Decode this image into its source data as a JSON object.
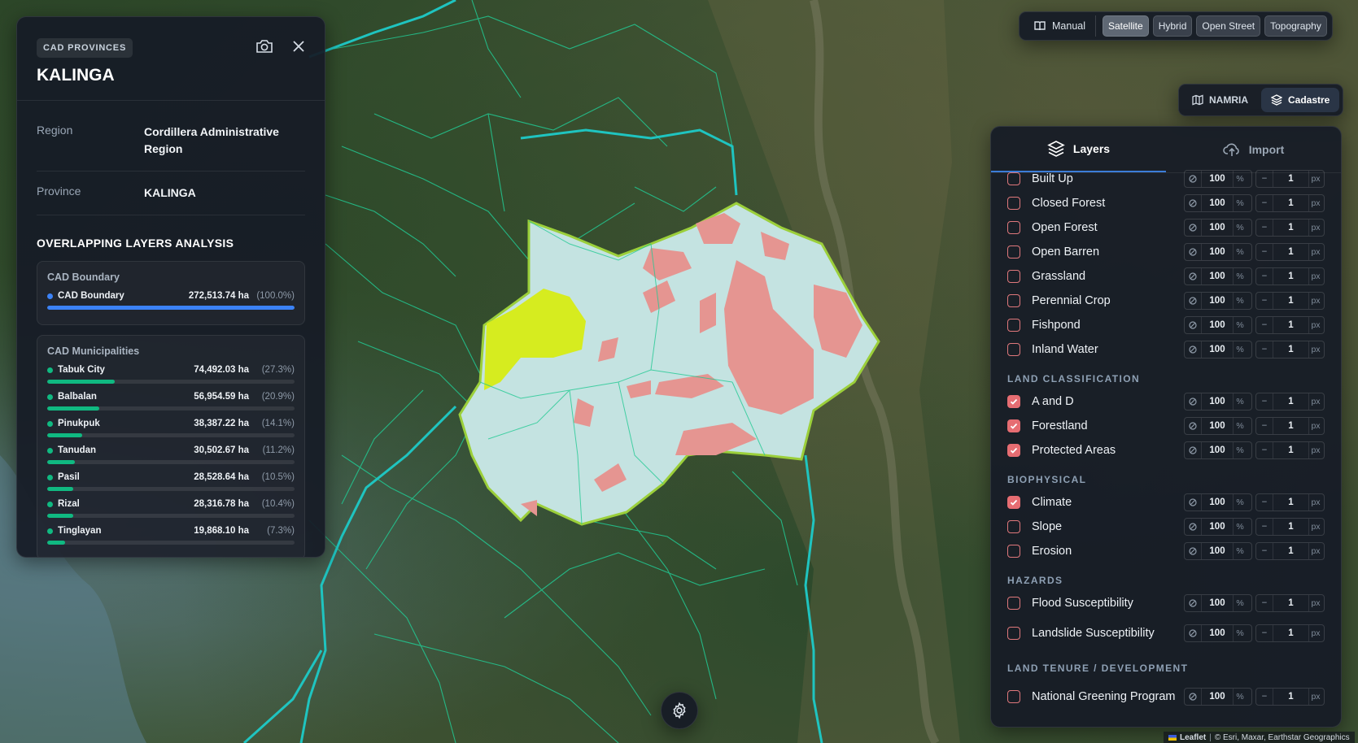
{
  "info": {
    "chip": "CAD PROVINCES",
    "title": "KALINGA",
    "region_label": "Region",
    "region_value": "Cordillera Administrative Region",
    "province_label": "Province",
    "province_value": "KALINGA",
    "analysis_title": "OVERLAPPING LAYERS ANALYSIS",
    "boundary_card": {
      "title": "CAD Boundary",
      "rows": [
        {
          "name": "CAD Boundary",
          "value": "272,513.74 ha",
          "pct": "(100.0%)",
          "fraction": 1.0,
          "color": "#3b82f6"
        }
      ]
    },
    "municipalities_card": {
      "title": "CAD Municipalities",
      "rows": [
        {
          "name": "Tabuk City",
          "value": "74,492.03 ha",
          "pct": "(27.3%)",
          "fraction": 0.273,
          "color": "#10b981"
        },
        {
          "name": "Balbalan",
          "value": "56,954.59 ha",
          "pct": "(20.9%)",
          "fraction": 0.209,
          "color": "#10b981"
        },
        {
          "name": "Pinukpuk",
          "value": "38,387.22 ha",
          "pct": "(14.1%)",
          "fraction": 0.141,
          "color": "#10b981"
        },
        {
          "name": "Tanudan",
          "value": "30,502.67 ha",
          "pct": "(11.2%)",
          "fraction": 0.112,
          "color": "#10b981"
        },
        {
          "name": "Pasil",
          "value": "28,528.64 ha",
          "pct": "(10.5%)",
          "fraction": 0.105,
          "color": "#10b981"
        },
        {
          "name": "Rizal",
          "value": "28,316.78 ha",
          "pct": "(10.4%)",
          "fraction": 0.104,
          "color": "#10b981"
        },
        {
          "name": "Tinglayan",
          "value": "19,868.10 ha",
          "pct": "(7.3%)",
          "fraction": 0.073,
          "color": "#10b981"
        }
      ]
    }
  },
  "toolbar": {
    "manual_label": "Manual",
    "basemaps": [
      "Satellite",
      "Hybrid",
      "Open Street",
      "Topography"
    ],
    "active_basemap": "Satellite",
    "sources": [
      "NAMRIA",
      "Cadastre"
    ],
    "active_source": "Cadastre"
  },
  "layers_panel": {
    "tabs": [
      "Layers",
      "Import"
    ],
    "active_tab": "Layers",
    "unit_percent": "%",
    "unit_px": "px",
    "minus_symbol": "−",
    "groups": [
      {
        "title": "",
        "items": [
          {
            "name": "Built Up",
            "checked": false,
            "opacity": "100",
            "width": "1"
          },
          {
            "name": "Closed Forest",
            "checked": false,
            "opacity": "100",
            "width": "1"
          },
          {
            "name": "Open Forest",
            "checked": false,
            "opacity": "100",
            "width": "1"
          },
          {
            "name": "Open Barren",
            "checked": false,
            "opacity": "100",
            "width": "1"
          },
          {
            "name": "Grassland",
            "checked": false,
            "opacity": "100",
            "width": "1"
          },
          {
            "name": "Perennial Crop",
            "checked": false,
            "opacity": "100",
            "width": "1"
          },
          {
            "name": "Fishpond",
            "checked": false,
            "opacity": "100",
            "width": "1"
          },
          {
            "name": "Inland Water",
            "checked": false,
            "opacity": "100",
            "width": "1"
          }
        ]
      },
      {
        "title": "LAND CLASSIFICATION",
        "items": [
          {
            "name": "A and D",
            "checked": true,
            "opacity": "100",
            "width": "1"
          },
          {
            "name": "Forestland",
            "checked": true,
            "opacity": "100",
            "width": "1"
          },
          {
            "name": "Protected Areas",
            "checked": true,
            "opacity": "100",
            "width": "1"
          }
        ]
      },
      {
        "title": "BIOPHYSICAL",
        "items": [
          {
            "name": "Climate",
            "checked": true,
            "opacity": "100",
            "width": "1"
          },
          {
            "name": "Slope",
            "checked": false,
            "opacity": "100",
            "width": "1"
          },
          {
            "name": "Erosion",
            "checked": false,
            "opacity": "100",
            "width": "1"
          }
        ]
      },
      {
        "title": "HAZARDS",
        "items": [
          {
            "name": "Flood Susceptibility",
            "checked": false,
            "opacity": "100",
            "width": "1"
          },
          {
            "name": "Landslide Susceptibility",
            "checked": false,
            "opacity": "100",
            "width": "1"
          }
        ]
      },
      {
        "title": "LAND TENURE / DEVELOPMENT",
        "items": [
          {
            "name": "National Greening Program",
            "checked": false,
            "opacity": "100",
            "width": "1"
          }
        ]
      }
    ]
  },
  "attribution": {
    "leaflet": "Leaflet",
    "sep": "|",
    "credits": "© Esri, Maxar, Earthstar Geographics"
  },
  "colors": {
    "accent": "#3b7dd8",
    "checkbox": "#e66d72",
    "province_fill": "#c4e3e1",
    "overlay_red": "#e59591",
    "overlay_yellow": "#d6ec1f",
    "boundary_cyan": "#1fc4c0",
    "municipal_green": "#22c993"
  }
}
